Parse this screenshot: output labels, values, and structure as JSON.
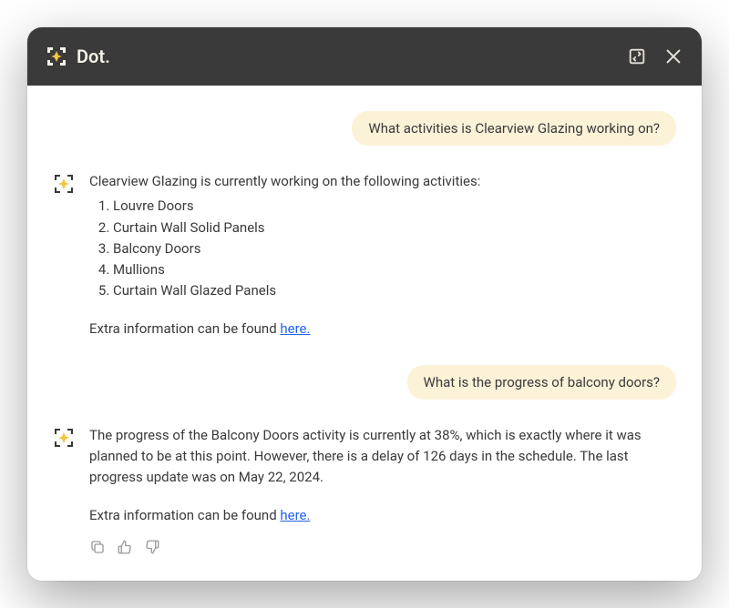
{
  "app": {
    "title": "Dot."
  },
  "conversation": {
    "user_message_1": "What activities is Clearview Glazing working on?",
    "assistant_1": {
      "intro": "Clearview Glazing is currently working on the following activities:",
      "items": {
        "0": "Louvre Doors",
        "1": "Curtain Wall Solid Panels",
        "2": "Balcony Doors",
        "3": "Mullions",
        "4": "Curtain Wall Glazed Panels"
      },
      "extra_prefix": "Extra information can be found ",
      "extra_link": "here."
    },
    "user_message_2": "What is the progress of balcony doors?",
    "assistant_2": {
      "body": "The progress of the Balcony Doors activity is currently at 38%, which is exactly where it was planned to be at this point. However, there is a delay of 126 days in the schedule. The last progress update was on May 22, 2024.",
      "extra_prefix": "Extra information can be found ",
      "extra_link": "here."
    }
  }
}
